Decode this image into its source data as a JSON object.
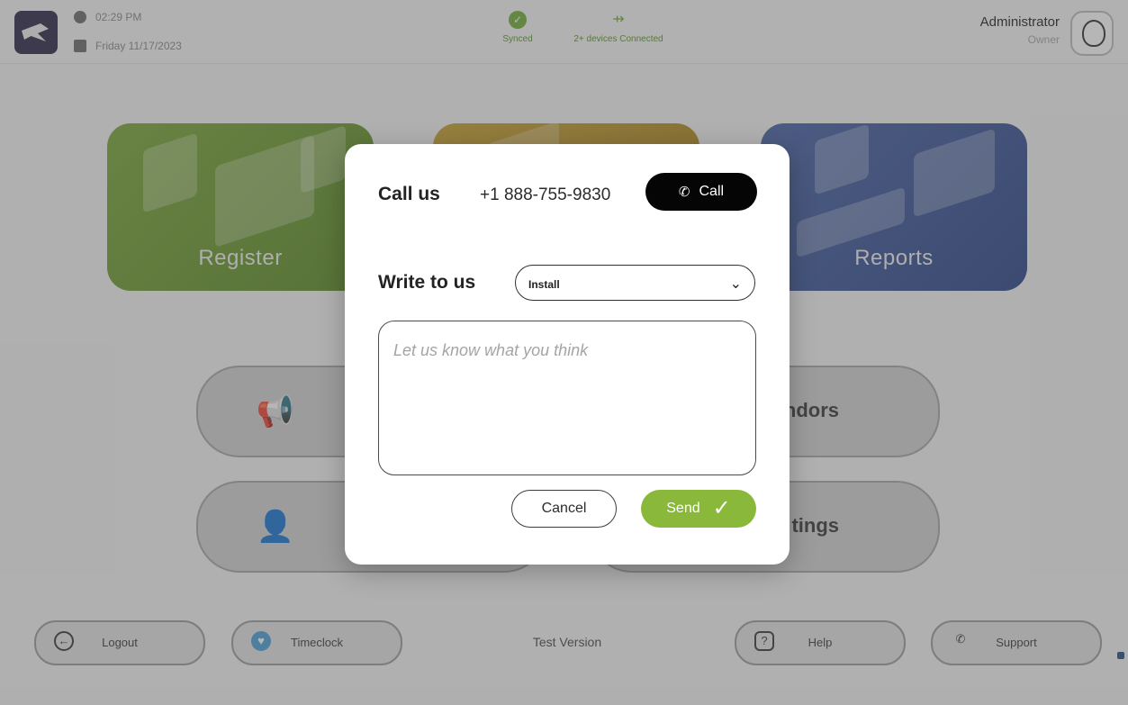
{
  "header": {
    "time": "02:29 PM",
    "date": "Friday 11/17/2023",
    "sync_label": "Synced",
    "devices_label": "2+ devices Connected",
    "user_name": "Administrator",
    "user_role": "Owner"
  },
  "tiles": {
    "register": "Register",
    "reports": "Reports"
  },
  "pills": {
    "vendors_partial": "ndors",
    "settings_partial": "tings"
  },
  "footer": {
    "logout": "Logout",
    "timeclock": "Timeclock",
    "test_version": "Test Version",
    "help": "Help",
    "support": "Support"
  },
  "modal": {
    "call_title": "Call us",
    "phone": "+1 888-755-9830",
    "call_button": "Call",
    "write_title": "Write to us",
    "topic_selected": "Install",
    "message_placeholder": "Let us know what you think",
    "cancel_button": "Cancel",
    "send_button": "Send"
  },
  "colors": {
    "accent_green": "#8ab83a",
    "sync_green": "#73b03a",
    "register_tile": "#6c9a30",
    "reports_tile": "#3b559a",
    "call_black": "#050505"
  },
  "icons": [
    "clock-icon",
    "calendar-icon",
    "sync-check-icon",
    "usb-icon",
    "avatar-icon",
    "megaphone-icon",
    "user-list-icon",
    "logout-icon",
    "timeclock-icon",
    "help-icon",
    "support-phone-icon",
    "phone-icon",
    "chevron-down-icon",
    "checkmark-icon"
  ]
}
